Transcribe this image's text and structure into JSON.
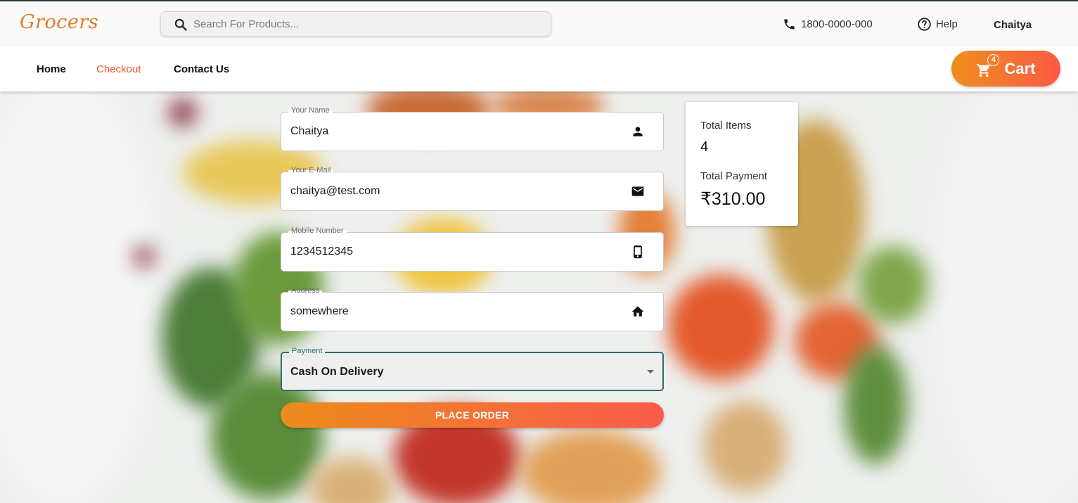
{
  "header": {
    "logo": "Grocers",
    "search_placeholder": "Search For Products...",
    "phone": "1800-0000-000",
    "help_label": "Help",
    "username": "Chaitya"
  },
  "nav": {
    "items": [
      {
        "label": "Home",
        "active": false
      },
      {
        "label": "Checkout",
        "active": true
      },
      {
        "label": "Contact Us",
        "active": false
      }
    ],
    "cart_label": "Cart",
    "cart_count": "4"
  },
  "form": {
    "name": {
      "label": "Your Name",
      "value": "Chaitya",
      "icon": "person-icon"
    },
    "email": {
      "label": "Your E-Mail",
      "value": "chaitya@test.com",
      "icon": "mail-icon"
    },
    "mobile": {
      "label": "Mobile Number",
      "value": "1234512345",
      "icon": "phone-icon"
    },
    "address": {
      "label": "Address",
      "value": "somewhere",
      "icon": "home-icon"
    },
    "payment": {
      "label": "Payment",
      "value": "Cash On Delivery"
    },
    "submit_label": "PLACE ORDER"
  },
  "summary": {
    "items_label": "Total Items",
    "items_value": "4",
    "payment_label": "Total Payment",
    "payment_value": "₹310.00"
  },
  "colors": {
    "brand": "#e8782a",
    "accent_start": "#ee8e1e",
    "accent_end": "#fb5a45",
    "active_nav": "#f0592a",
    "focus": "#2e6f6a"
  }
}
